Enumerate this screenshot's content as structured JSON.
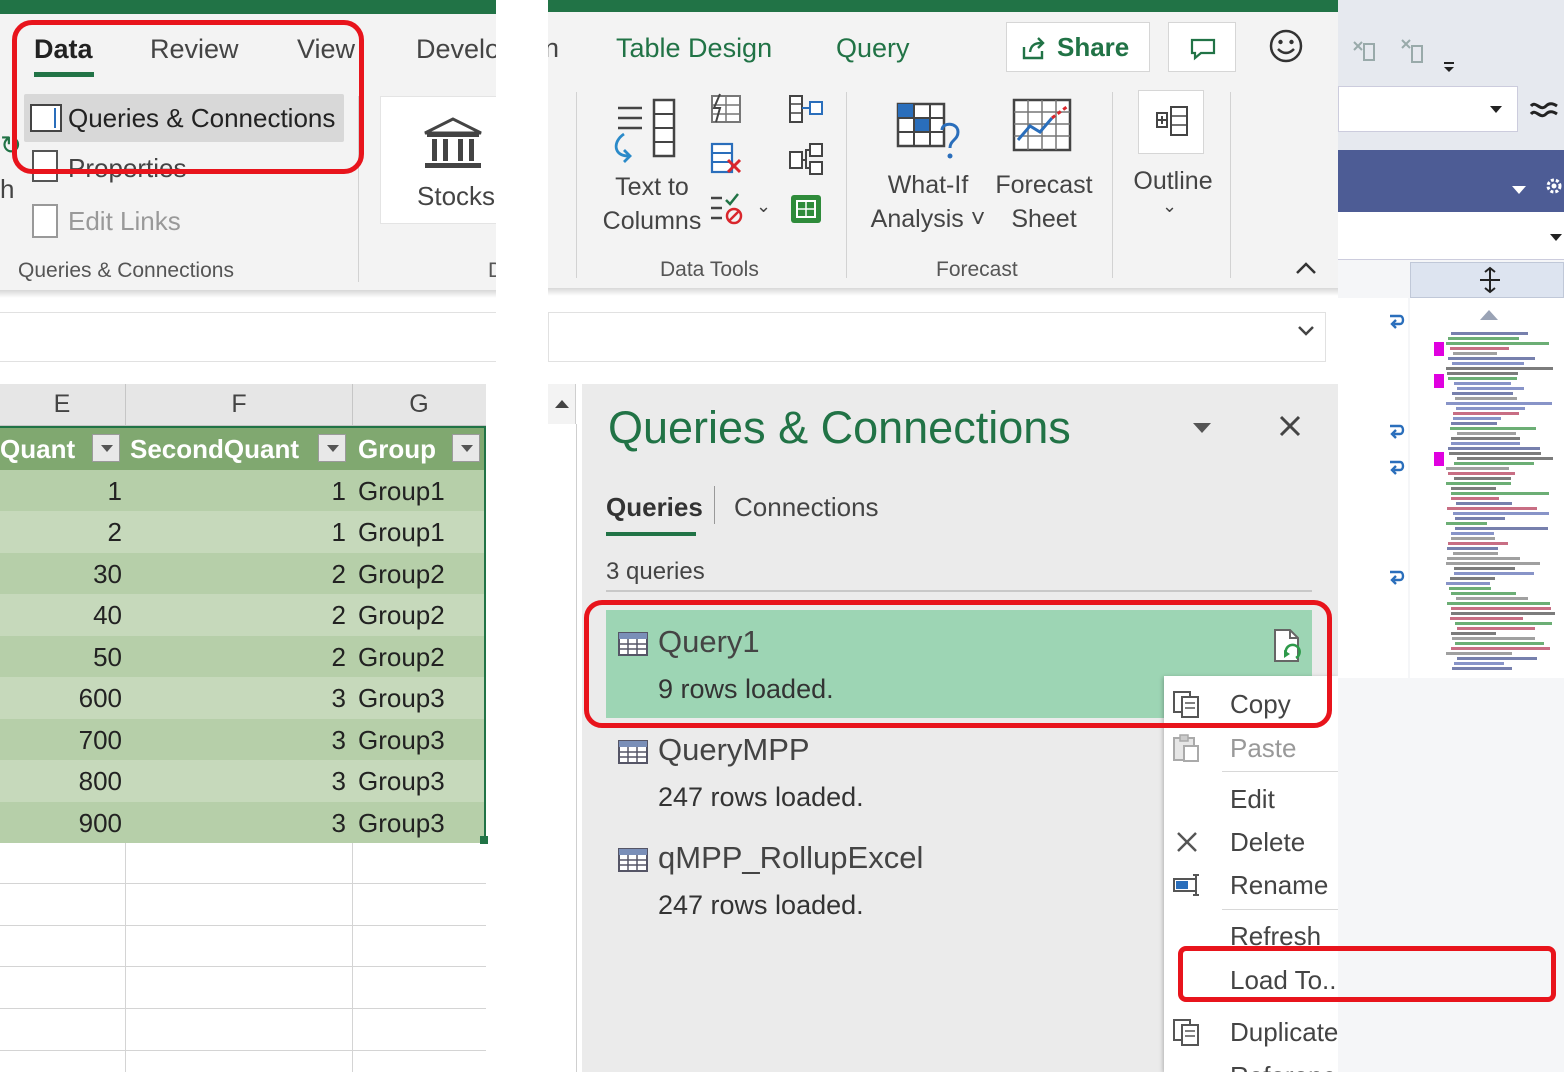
{
  "left_ribbon": {
    "tabs": [
      "Data",
      "Review",
      "View",
      "Develo"
    ],
    "refresh_fragment": "h",
    "queries_connections_button": "Queries & Connections",
    "properties_button": "Properties",
    "edit_links_button": "Edit Links",
    "group_label": "Queries & Connections",
    "stocks_button": "Stocks",
    "right_group_fragment": "D"
  },
  "spreadsheet": {
    "column_letters": [
      "E",
      "F",
      "G"
    ],
    "headers": [
      "Quant",
      "SecondQuant",
      "Group"
    ],
    "rows": [
      [
        "1",
        "1",
        "Group1"
      ],
      [
        "2",
        "1",
        "Group1"
      ],
      [
        "30",
        "2",
        "Group2"
      ],
      [
        "40",
        "2",
        "Group2"
      ],
      [
        "50",
        "2",
        "Group2"
      ],
      [
        "600",
        "3",
        "Group3"
      ],
      [
        "700",
        "3",
        "Group3"
      ],
      [
        "800",
        "3",
        "Group3"
      ],
      [
        "900",
        "3",
        "Group3"
      ]
    ]
  },
  "right_ribbon": {
    "tab_fragment": "n",
    "tabs": [
      "Table Design",
      "Query"
    ],
    "share_label": "Share",
    "text_to_columns": [
      "Text to",
      "Columns"
    ],
    "data_tools_label": "Data Tools",
    "what_if": [
      "What-If",
      "Analysis ˅"
    ],
    "forecast_sheet": [
      "Forecast",
      "Sheet"
    ],
    "forecast_label": "Forecast",
    "outline_label": "Outline"
  },
  "queries_pane": {
    "title": "Queries & Connections",
    "tabs": [
      "Queries",
      "Connections"
    ],
    "count_text": "3 queries",
    "queries": [
      {
        "name": "Query1",
        "status": "9 rows loaded."
      },
      {
        "name": "QueryMPP",
        "status": "247 rows loaded."
      },
      {
        "name": "qMPP_RollupExcel",
        "status": "247 rows loaded."
      }
    ]
  },
  "context_menu": {
    "copy": "Copy",
    "paste": "Paste",
    "edit": "Edit",
    "delete": "Delete",
    "rename": "Rename",
    "refresh": "Refresh",
    "load_to": "Load To...",
    "duplicate": "Duplicate",
    "reference": "Reference"
  },
  "colors": {
    "excel_green": "#217346",
    "selected_query": "#9dd5b4",
    "highlight_red": "#e8141c",
    "table_header": "#80a870"
  },
  "icons": [
    "queries-connections-icon",
    "properties-icon",
    "edit-links-icon",
    "stocks-icon",
    "share-icon",
    "comment-icon",
    "smiley-feedback-icon",
    "text-to-columns-icon",
    "flash-fill-icon",
    "remove-duplicates-icon",
    "data-validation-icon",
    "consolidate-icon",
    "relationships-icon",
    "manage-data-model-icon",
    "what-if-icon",
    "forecast-sheet-icon",
    "outline-icon",
    "close-icon",
    "table-icon",
    "refresh-query-icon",
    "copy-icon",
    "paste-icon",
    "delete-icon",
    "rename-icon",
    "duplicate-icon"
  ]
}
